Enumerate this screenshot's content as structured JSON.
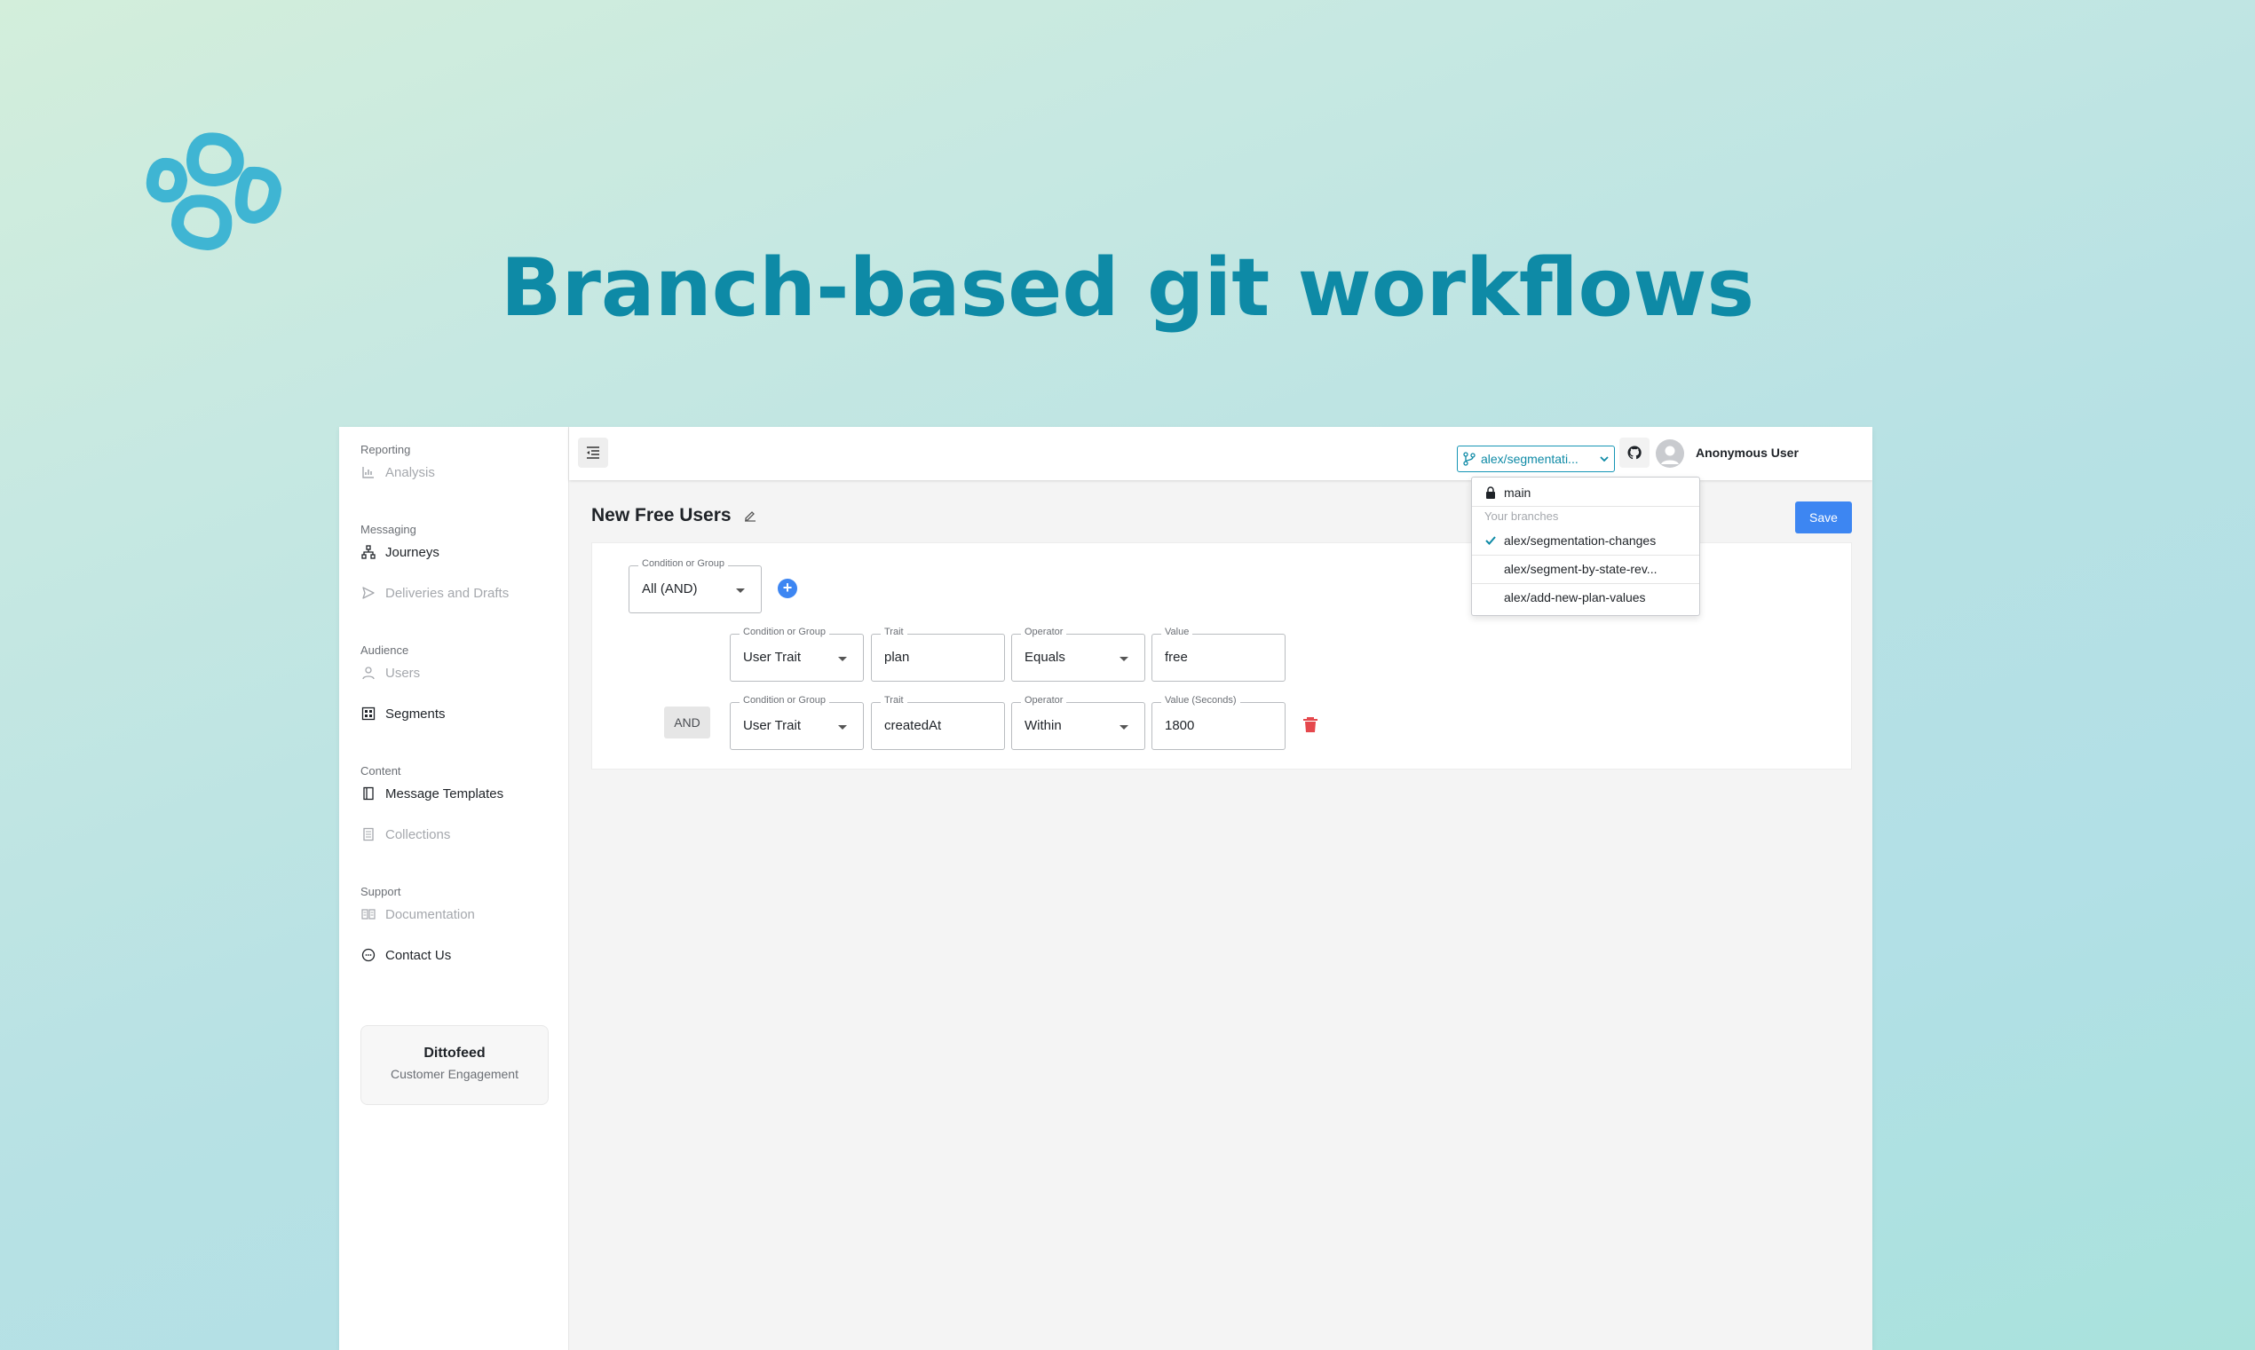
{
  "headline": "Branch-based git workflows",
  "sidebar": {
    "sections": {
      "reporting": "Reporting",
      "messaging": "Messaging",
      "audience": "Audience",
      "content": "Content",
      "support": "Support"
    },
    "items": {
      "analysis": "Analysis",
      "journeys": "Journeys",
      "deliveries": "Deliveries and Drafts",
      "users": "Users",
      "segments": "Segments",
      "message_templates": "Message Templates",
      "collections": "Collections",
      "documentation": "Documentation",
      "contact": "Contact Us"
    },
    "brand": {
      "name": "Dittofeed",
      "subtitle": "Customer Engagement"
    }
  },
  "topbar": {
    "branch_selected": "alex/segmentati...",
    "username": "Anonymous User"
  },
  "branch_menu": {
    "main": "main",
    "header": "Your branches",
    "branches": [
      "alex/segmentation-changes",
      "alex/segment-by-state-rev...",
      "alex/add-new-plan-values"
    ]
  },
  "page": {
    "title": "New Free Users",
    "save_label": "Save"
  },
  "editor": {
    "root": {
      "label": "Condition or Group",
      "value": "All (AND)"
    },
    "and_label": "AND",
    "rows": [
      {
        "group": {
          "label": "Condition or Group",
          "value": "User Trait"
        },
        "trait": {
          "label": "Trait",
          "value": "plan"
        },
        "operator": {
          "label": "Operator",
          "value": "Equals"
        },
        "value": {
          "label": "Value",
          "value": "free"
        }
      },
      {
        "group": {
          "label": "Condition or Group",
          "value": "User Trait"
        },
        "trait": {
          "label": "Trait",
          "value": "createdAt"
        },
        "operator": {
          "label": "Operator",
          "value": "Within"
        },
        "value": {
          "label": "Value (Seconds)",
          "value": "1800"
        }
      }
    ]
  },
  "colors": {
    "accent": "#0e8aa6",
    "primary_button": "#3d86f2",
    "danger": "#e5484d"
  }
}
